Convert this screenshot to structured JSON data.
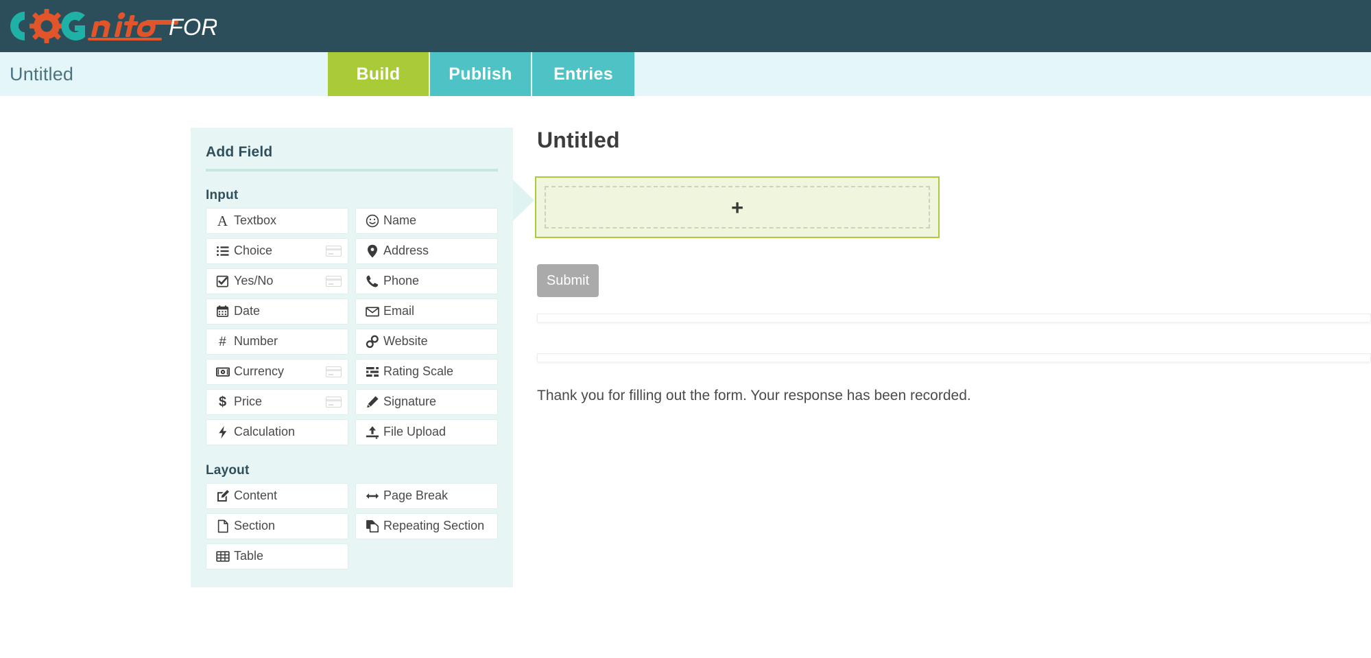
{
  "brand": {
    "name_part1": "COG",
    "name_part2": "nito",
    "name_part3": "FORMS",
    "bar_color": "#2b4e5a",
    "teal": "#1fb0a6",
    "orange": "#e2552a"
  },
  "header": {
    "form_title": "Untitled",
    "tabs": [
      {
        "label": "Build",
        "active": true,
        "color": "#a9cb37"
      },
      {
        "label": "Publish",
        "active": false,
        "color": "#4ec3c6"
      },
      {
        "label": "Entries",
        "active": false,
        "color": "#4ec3c6"
      }
    ]
  },
  "add_field_panel": {
    "heading": "Add Field",
    "groups": [
      {
        "label": "Input",
        "fields": [
          {
            "label": "Textbox",
            "icon": "textbox-letter-a-icon",
            "badge": false
          },
          {
            "label": "Name",
            "icon": "smiley-face-icon",
            "badge": false
          },
          {
            "label": "Choice",
            "icon": "bullet-list-icon",
            "badge": true
          },
          {
            "label": "Address",
            "icon": "map-pin-icon",
            "badge": false
          },
          {
            "label": "Yes/No",
            "icon": "checked-box-icon",
            "badge": true
          },
          {
            "label": "Phone",
            "icon": "phone-handset-icon",
            "badge": false
          },
          {
            "label": "Date",
            "icon": "calendar-icon",
            "badge": false
          },
          {
            "label": "Email",
            "icon": "envelope-icon",
            "badge": false
          },
          {
            "label": "Number",
            "icon": "hash-icon",
            "badge": false
          },
          {
            "label": "Website",
            "icon": "link-chain-icon",
            "badge": false
          },
          {
            "label": "Currency",
            "icon": "money-bill-icon",
            "badge": true
          },
          {
            "label": "Rating Scale",
            "icon": "sliders-icon",
            "badge": false
          },
          {
            "label": "Price",
            "icon": "dollar-sign-icon",
            "badge": true
          },
          {
            "label": "Signature",
            "icon": "pencil-icon",
            "badge": false
          },
          {
            "label": "Calculation",
            "icon": "lightning-bolt-icon",
            "badge": false
          },
          {
            "label": "File Upload",
            "icon": "upload-icon",
            "badge": false
          }
        ]
      },
      {
        "label": "Layout",
        "fields": [
          {
            "label": "Content",
            "icon": "edit-square-icon",
            "badge": false
          },
          {
            "label": "Page Break",
            "icon": "arrows-lr-icon",
            "badge": false
          },
          {
            "label": "Section",
            "icon": "document-icon",
            "badge": false
          },
          {
            "label": "Repeating Section",
            "icon": "copy-icon",
            "badge": false
          },
          {
            "label": "Table",
            "icon": "table-grid-icon",
            "badge": false
          }
        ]
      }
    ]
  },
  "form_preview": {
    "title": "Untitled",
    "dropzone_plus": "+",
    "submit_label": "Submit",
    "confirmation_text": "Thank you for filling out the form. Your response has been recorded."
  }
}
